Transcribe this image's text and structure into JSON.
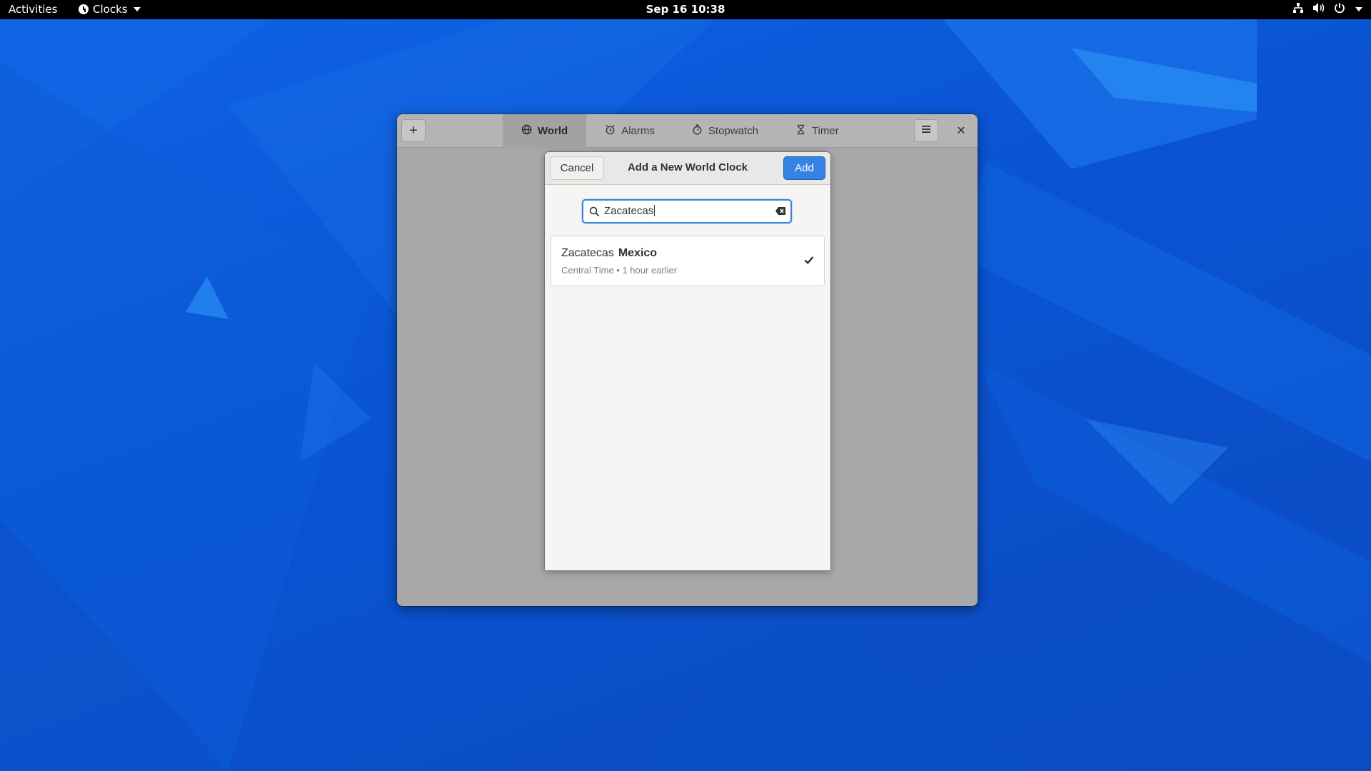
{
  "topbar": {
    "activities": "Activities",
    "app_name": "Clocks",
    "datetime": "Sep 16  10:38",
    "tray_icons": [
      "network-icon",
      "volume-icon",
      "power-icon"
    ]
  },
  "window": {
    "tabs": [
      {
        "label": "World",
        "icon": "globe-icon",
        "active": true
      },
      {
        "label": "Alarms",
        "icon": "alarm-icon",
        "active": false
      },
      {
        "label": "Stopwatch",
        "icon": "stopwatch-icon",
        "active": false
      },
      {
        "label": "Timer",
        "icon": "hourglass-icon",
        "active": false
      }
    ],
    "add_glyph": "+",
    "close_glyph": "✕"
  },
  "dialog": {
    "title": "Add a New World Clock",
    "cancel_label": "Cancel",
    "add_label": "Add",
    "search": {
      "value": "Zacatecas"
    },
    "results": [
      {
        "city": "Zacatecas",
        "country": "Mexico",
        "detail": "Central Time • 1 hour earlier",
        "selected": true
      }
    ]
  },
  "colors": {
    "accent": "#3584e4",
    "wallpaper": "#0a55d4",
    "topbar": "#000000"
  }
}
